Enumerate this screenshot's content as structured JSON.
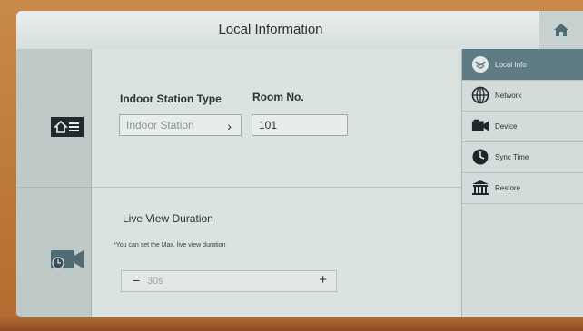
{
  "header": {
    "title": "Local Information"
  },
  "icons": {
    "home": "home-icon",
    "local_info": "info-disc-icon",
    "network": "globe-icon",
    "device": "camera-icon",
    "sync_time": "clock-icon",
    "restore": "restore-icon",
    "station_section": "home-list-icon",
    "live_view_section": "video-camera-icon"
  },
  "indoor_station": {
    "type_label": "Indoor Station Type",
    "type_value": "Indoor Station",
    "chevron": "›",
    "room_label": "Room No.",
    "room_value": "101"
  },
  "live_view": {
    "label": "Live View Duration",
    "note": "*You can set the Max. live view duration",
    "minus": "−",
    "value": "30s",
    "plus": "+"
  },
  "menu": {
    "items": [
      {
        "label": "Local Info",
        "active": true
      },
      {
        "label": "Network",
        "active": false
      },
      {
        "label": "Device",
        "active": false
      },
      {
        "label": "Sync Time",
        "active": false
      },
      {
        "label": "Restore",
        "active": false
      }
    ]
  },
  "colors": {
    "accent": "#5f7c84",
    "screen_bg": "#dbe3e1",
    "frame": "#b8743a"
  }
}
